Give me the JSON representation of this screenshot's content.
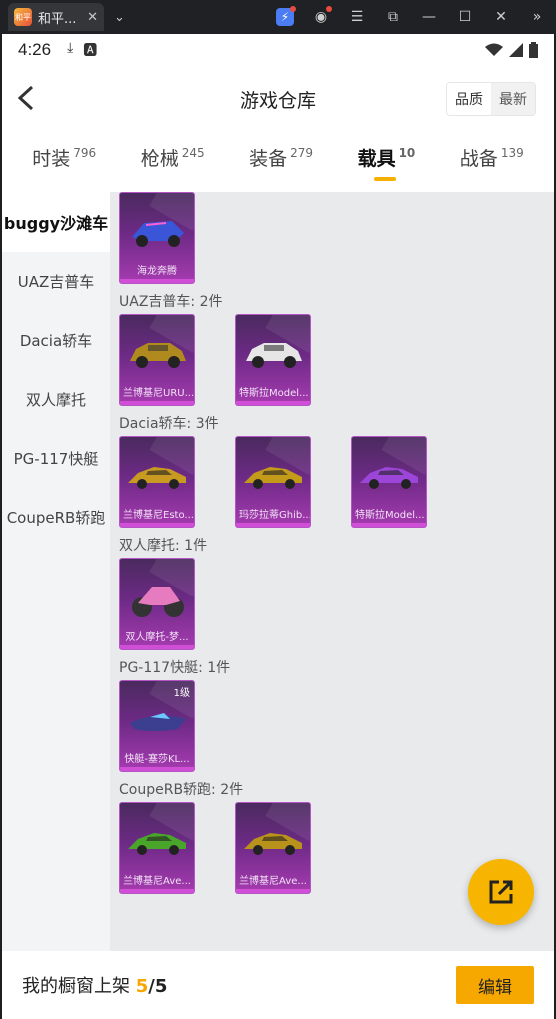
{
  "window": {
    "tab_title": "和平...",
    "favicon_text": "和平",
    "icons": [
      "bolt-icon",
      "account-icon",
      "menu-icon",
      "screenshot-icon",
      "minimize-icon",
      "maximize-icon",
      "close-icon",
      "more-icon"
    ]
  },
  "statusbar": {
    "time": "4:26"
  },
  "appbar": {
    "title": "游戏仓库",
    "sort_quality": "品质",
    "sort_latest": "最新"
  },
  "categories": [
    {
      "label": "时装",
      "count": "796"
    },
    {
      "label": "枪械",
      "count": "245"
    },
    {
      "label": "装备",
      "count": "279"
    },
    {
      "label": "载具",
      "count": "10"
    },
    {
      "label": "战备",
      "count": "139"
    }
  ],
  "active_category": "载具",
  "sidebar": [
    {
      "label": "buggy沙滩车"
    },
    {
      "label": "UAZ吉普车"
    },
    {
      "label": "Dacia轿车"
    },
    {
      "label": "双人摩托"
    },
    {
      "label": "PG-117快艇"
    },
    {
      "label": "CoupeRB轿跑"
    }
  ],
  "groups": [
    {
      "title": "",
      "items": [
        {
          "name": "海龙奔腾",
          "vehicle": "buggy",
          "color": "#3a55d8"
        }
      ]
    },
    {
      "title": "UAZ吉普车: 2件",
      "items": [
        {
          "name": "兰博基尼URU...",
          "vehicle": "suv",
          "color": "#b08a1e"
        },
        {
          "name": "特斯拉Model...",
          "vehicle": "suv",
          "color": "#e6e6e6"
        }
      ]
    },
    {
      "title": "Dacia轿车: 3件",
      "items": [
        {
          "name": "兰博基尼Esto...",
          "vehicle": "car",
          "color": "#c99a22"
        },
        {
          "name": "玛莎拉蒂Ghib...",
          "vehicle": "car",
          "color": "#c49a1a"
        },
        {
          "name": "特斯拉Model...",
          "vehicle": "car",
          "color": "#9b46d8"
        }
      ]
    },
    {
      "title": "双人摩托: 1件",
      "items": [
        {
          "name": "双人摩托-梦...",
          "vehicle": "moto",
          "color": "#e77bc0"
        }
      ]
    },
    {
      "title": "PG-117快艇: 1件",
      "items": [
        {
          "name": "快艇-塞莎KL...",
          "vehicle": "boat",
          "color": "#3c3f8f",
          "level": "1级"
        }
      ]
    },
    {
      "title": "CoupeRB轿跑: 2件",
      "items": [
        {
          "name": "兰博基尼Ave...",
          "vehicle": "car",
          "color": "#4aa62a"
        },
        {
          "name": "兰博基尼Ave...",
          "vehicle": "car",
          "color": "#b8921a"
        }
      ]
    }
  ],
  "bottom": {
    "label": "我的橱窗上架",
    "count": "5",
    "sep_total": "/5",
    "edit_label": "编辑"
  }
}
